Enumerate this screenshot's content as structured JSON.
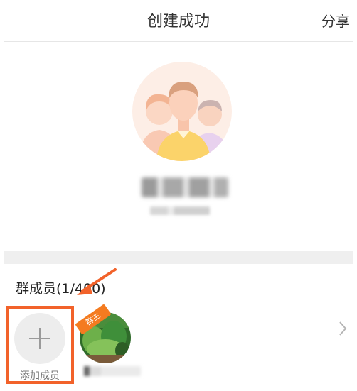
{
  "header": {
    "title": "创建成功",
    "share_label": "分享"
  },
  "group": {
    "avatar_icon": "group-avatar-icon"
  },
  "members": {
    "title": "群成员(1/400)",
    "add_label": "添加成员",
    "owner_badge": "群主"
  },
  "colors": {
    "accent": "#f2622a",
    "badge": "#f47b20",
    "band": "#efefef"
  }
}
